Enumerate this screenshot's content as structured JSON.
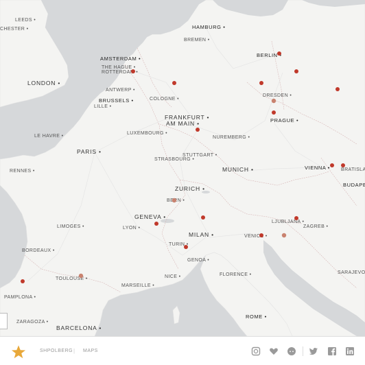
{
  "map": {
    "cities": [
      {
        "id": "leeds",
        "label": "LEEDS"
      },
      {
        "id": "manchester",
        "label": "CHESTER"
      },
      {
        "id": "hamburg",
        "label": "HAMBURG"
      },
      {
        "id": "bremen",
        "label": "BREMEN"
      },
      {
        "id": "berlin",
        "label": "BERLIN"
      },
      {
        "id": "amsterdam",
        "label": "AMSTERDAM"
      },
      {
        "id": "hague",
        "label": "THE HAGUE"
      },
      {
        "id": "rotterdam",
        "label": "ROTTERDAM"
      },
      {
        "id": "london",
        "label": "LONDON"
      },
      {
        "id": "antwerp",
        "label": "ANTWERP"
      },
      {
        "id": "brussels",
        "label": "BRUSSELS"
      },
      {
        "id": "cologne",
        "label": "COLOGNE"
      },
      {
        "id": "lille",
        "label": "LILLE"
      },
      {
        "id": "dresden",
        "label": "DRESDEN"
      },
      {
        "id": "frankfurt1",
        "label": "FRANKFURT"
      },
      {
        "id": "frankfurt2",
        "label": "AM MAIN"
      },
      {
        "id": "prague",
        "label": "PRAGUE"
      },
      {
        "id": "lehavre",
        "label": "LE HAVRE"
      },
      {
        "id": "luxembourg",
        "label": "LUXEMBOURG"
      },
      {
        "id": "nuremberg",
        "label": "NUREMBERG"
      },
      {
        "id": "paris",
        "label": "PARIS"
      },
      {
        "id": "stuttgart",
        "label": "STUTTGART"
      },
      {
        "id": "strasbourg",
        "label": "STRASBOURG"
      },
      {
        "id": "rennes",
        "label": "RENNES"
      },
      {
        "id": "munich",
        "label": "MUNICH"
      },
      {
        "id": "vienna",
        "label": "VIENNA"
      },
      {
        "id": "bratislava",
        "label": "BRATISLAVA"
      },
      {
        "id": "zurich",
        "label": "ZURICH"
      },
      {
        "id": "budapest",
        "label": "BUDAPES"
      },
      {
        "id": "bern",
        "label": "BERN"
      },
      {
        "id": "limoges",
        "label": "LIMOGES"
      },
      {
        "id": "lyon",
        "label": "LYON"
      },
      {
        "id": "geneva",
        "label": "GENEVA"
      },
      {
        "id": "ljubljana",
        "label": "LJUBLJANA"
      },
      {
        "id": "zagreb",
        "label": "ZAGREB"
      },
      {
        "id": "milan",
        "label": "MILAN"
      },
      {
        "id": "venice",
        "label": "VENICE"
      },
      {
        "id": "turin",
        "label": "TURIN"
      },
      {
        "id": "bordeaux",
        "label": "BORDEAUX"
      },
      {
        "id": "genoa",
        "label": "GENOA"
      },
      {
        "id": "toulouse",
        "label": "TOULOUSE"
      },
      {
        "id": "marseille",
        "label": "MARSEILLE"
      },
      {
        "id": "nice",
        "label": "NICE"
      },
      {
        "id": "florence",
        "label": "FLORENCE"
      },
      {
        "id": "sarajevo",
        "label": "SARAJEVO"
      },
      {
        "id": "pamplona",
        "label": "PAMPLONA"
      },
      {
        "id": "zaragoza",
        "label": "ZARAGOZA"
      },
      {
        "id": "rome",
        "label": "ROME"
      },
      {
        "id": "barcelona",
        "label": "BARCELONA"
      }
    ],
    "marker_color": "#c0392b",
    "marker_faded_color": "#c9826f",
    "land_color": "#f4f4f2",
    "water_color": "#d6d8da"
  },
  "footer": {
    "brand": "SHPOLBERG",
    "separator": "|",
    "maps_link": "MAPS",
    "icons": [
      "instagram-icon",
      "heart-icon",
      "reddit-icon",
      "twitter-icon",
      "facebook-icon",
      "linkedin-icon"
    ],
    "star_color": "#e8a83a"
  }
}
